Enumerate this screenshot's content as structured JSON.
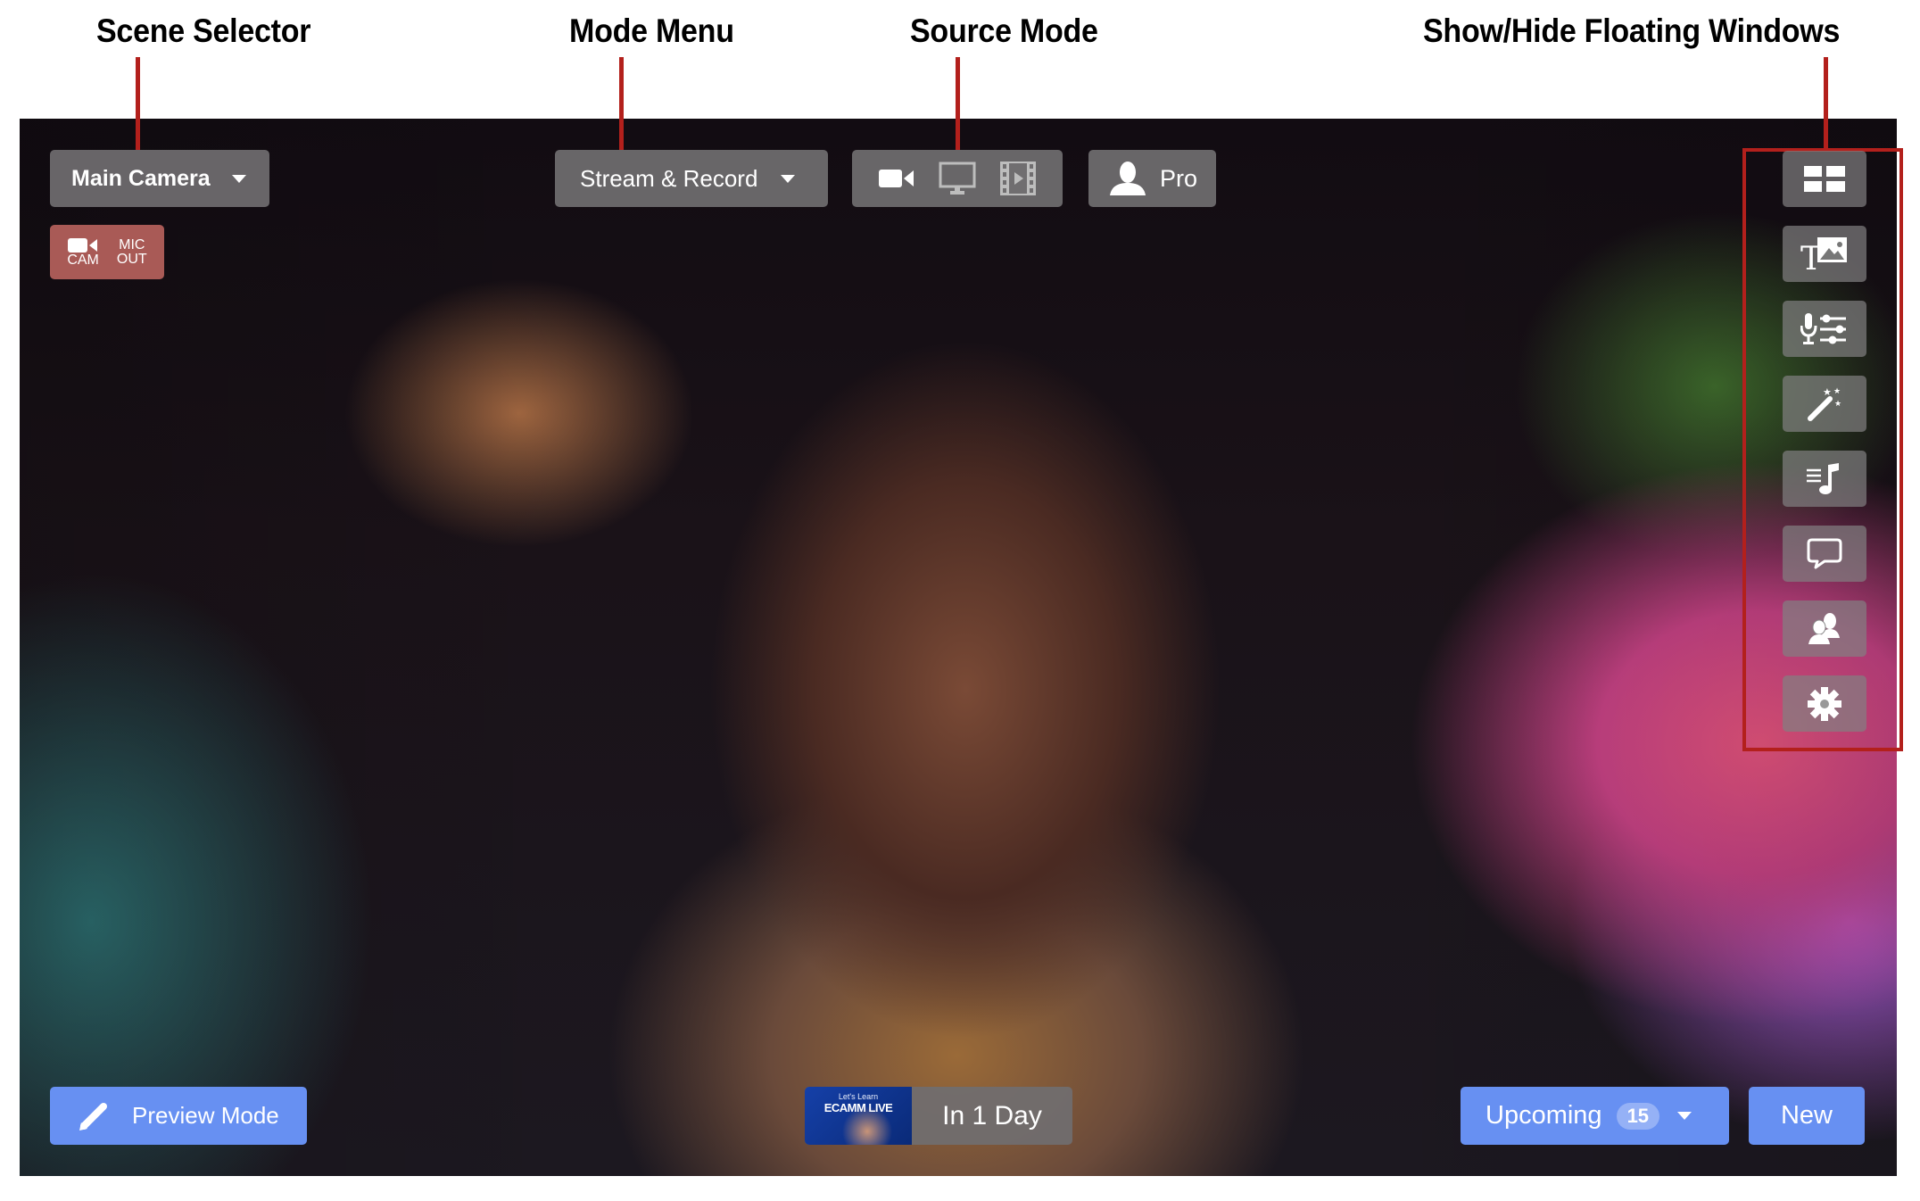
{
  "annotations": {
    "scene_selector": "Scene Selector",
    "mode_menu": "Mode Menu",
    "source_mode": "Source Mode",
    "floating_windows": "Show/Hide Floating Windows"
  },
  "toolbar": {
    "scene": "Main Camera",
    "mode": "Stream & Record",
    "plan": "Pro",
    "source_modes": [
      "camera-icon",
      "screen-share-icon",
      "video-file-icon"
    ]
  },
  "status_badge": {
    "cam_label": "CAM",
    "mic_label_1": "MIC",
    "mic_label_2": "OUT"
  },
  "side_panel": {
    "buttons": [
      "scene-grid-icon",
      "titles-overlay-icon",
      "audio-mixer-icon",
      "effects-wand-icon",
      "soundboard-icon",
      "comments-icon",
      "interview-guests-icon",
      "settings-gear-icon"
    ]
  },
  "bottom_bar": {
    "preview_mode": "Preview Mode",
    "event_thumbnail_line1": "Let's Learn",
    "event_thumbnail_line2": "ECAMM LIVE",
    "event_time": "In 1 Day",
    "upcoming": "Upcoming",
    "upcoming_count": "15",
    "new": "New"
  },
  "colors": {
    "accent_blue": "#6790f2",
    "annotation_red": "#b3201c",
    "badge_red": "#a95a56"
  }
}
